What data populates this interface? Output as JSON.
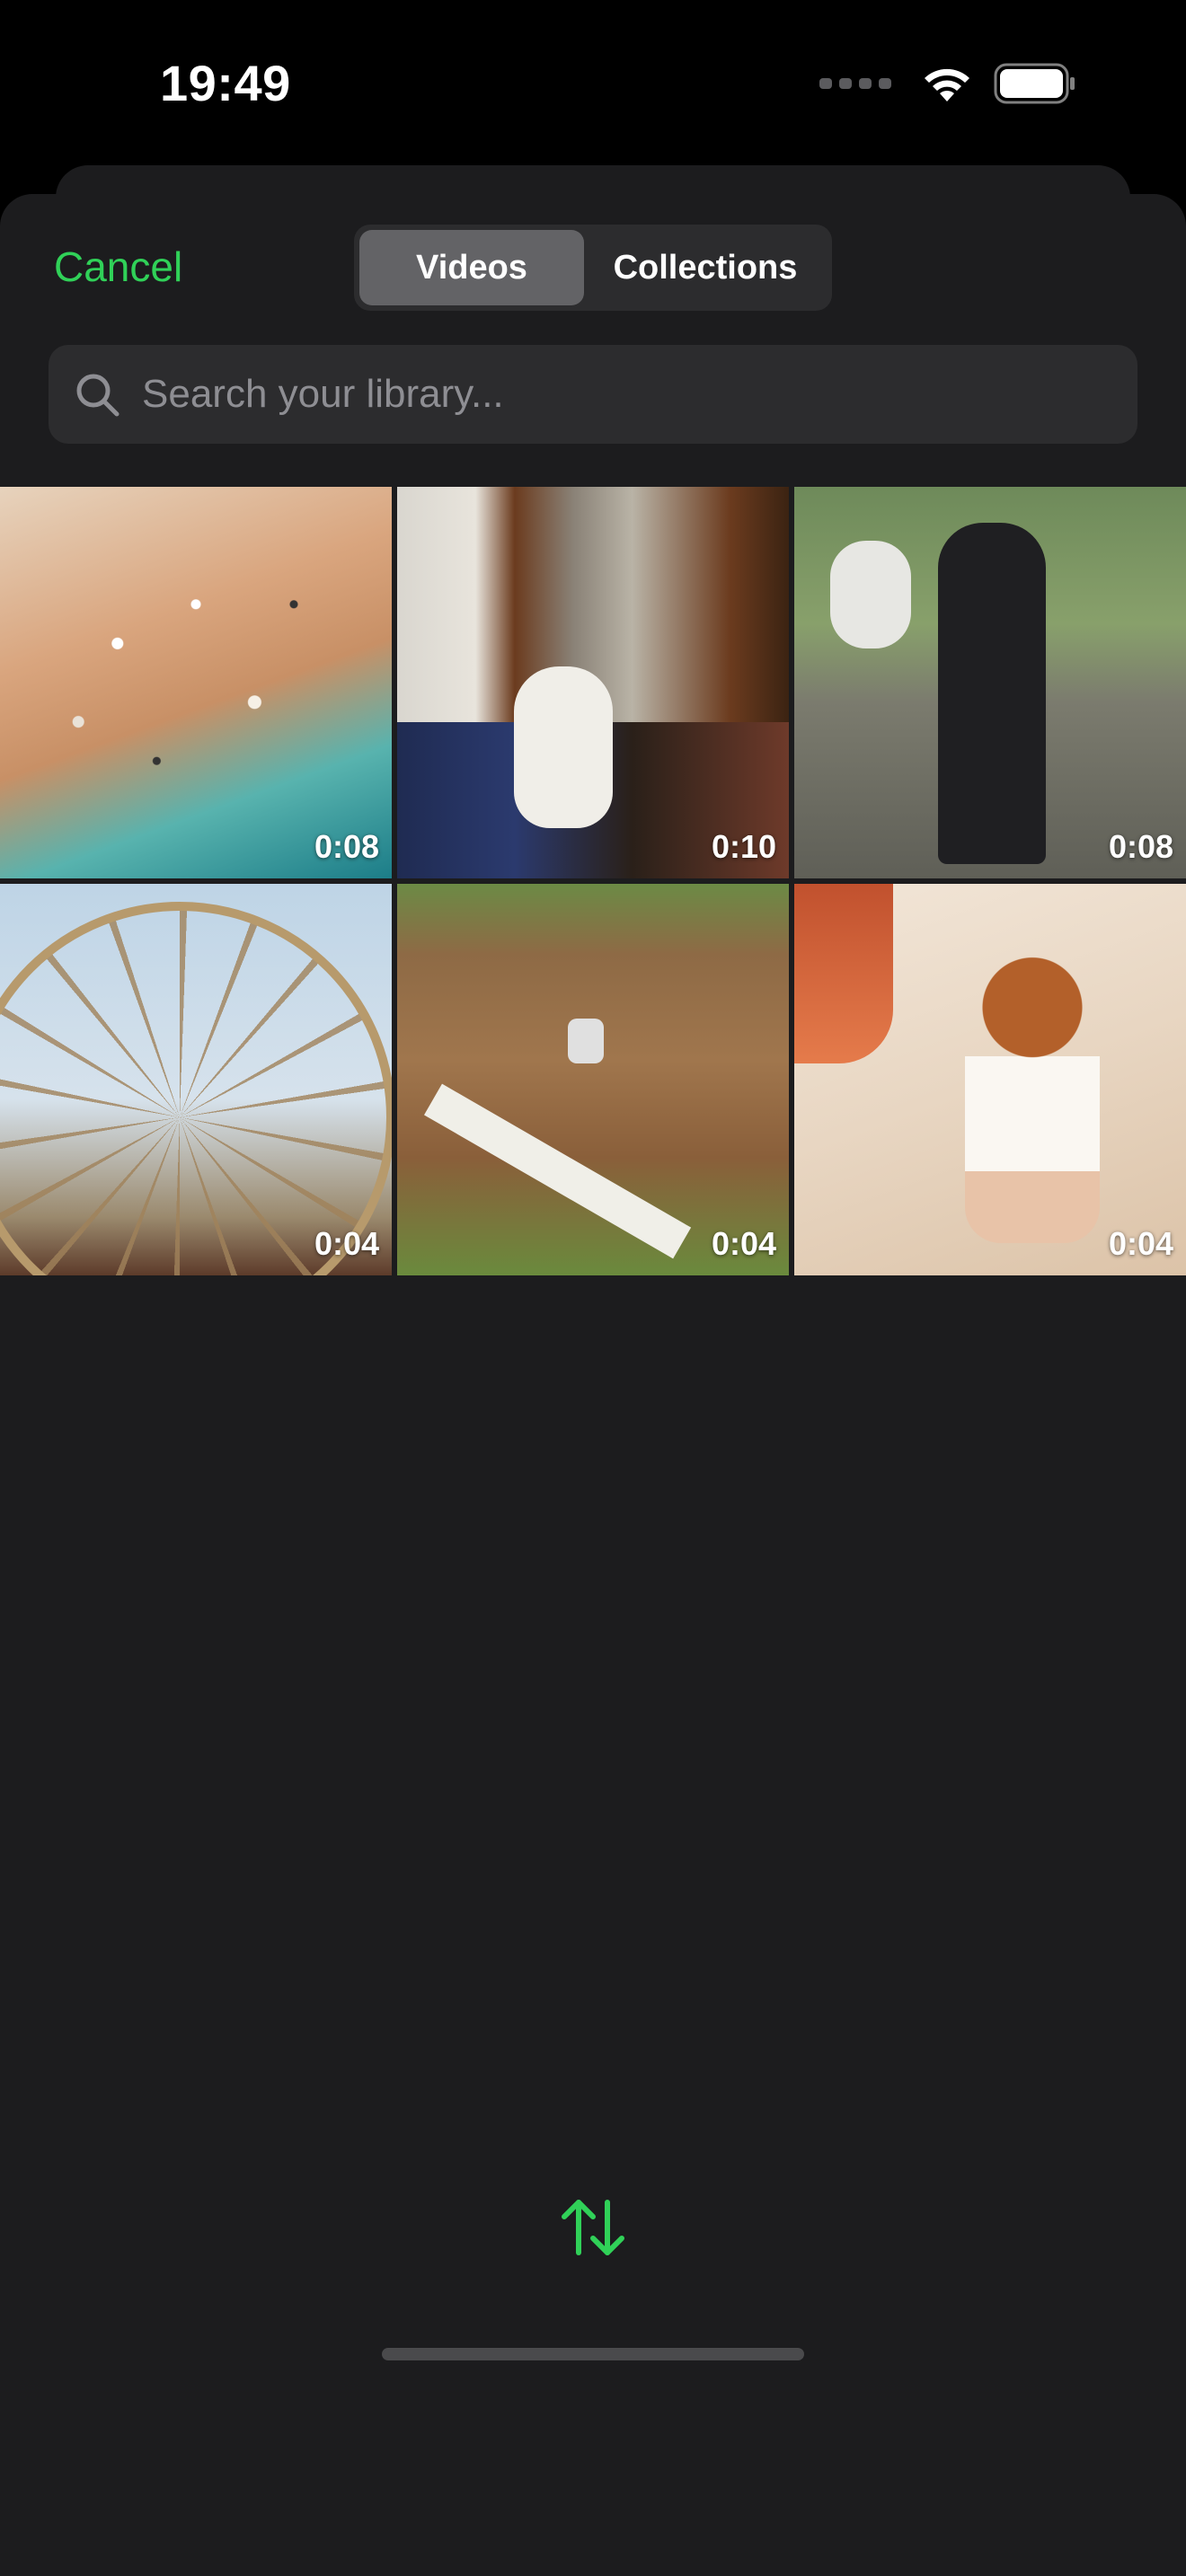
{
  "status_bar": {
    "time": "19:49"
  },
  "header": {
    "cancel_label": "Cancel",
    "tabs": [
      {
        "label": "Videos",
        "active": true
      },
      {
        "label": "Collections",
        "active": false
      }
    ]
  },
  "search": {
    "placeholder": "Search your library...",
    "value": ""
  },
  "videos": [
    {
      "subject": "beach",
      "duration": "0:08"
    },
    {
      "subject": "cat",
      "duration": "0:10"
    },
    {
      "subject": "dog",
      "duration": "0:08"
    },
    {
      "subject": "ferris wheel",
      "duration": "0:04"
    },
    {
      "subject": "motocross",
      "duration": "0:04"
    },
    {
      "subject": "child on beach",
      "duration": "0:04"
    }
  ],
  "icons": {
    "search": "search-icon",
    "sort": "sort-arrows-icon",
    "wifi": "wifi-icon",
    "battery": "battery-icon"
  },
  "colors": {
    "accent": "#30d158",
    "sheet_background": "#1c1c1e",
    "control_background": "#2c2c2e"
  }
}
